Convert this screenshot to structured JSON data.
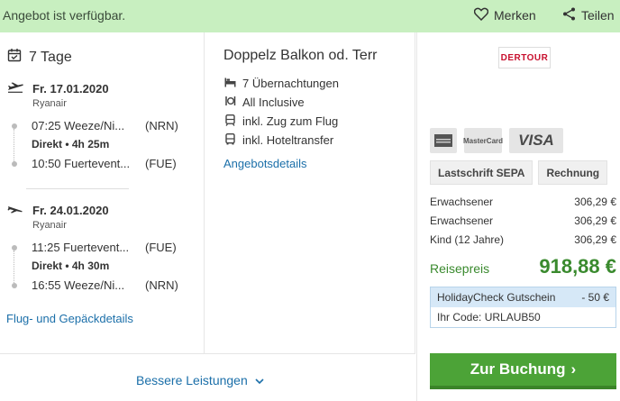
{
  "banner": {
    "availability": "Angebot ist verfügbar.",
    "save_label": "Merken",
    "share_label": "Teilen",
    "save_icon": "heart-icon",
    "share_icon": "share-icon"
  },
  "trip": {
    "duration": "7 Tage"
  },
  "outbound": {
    "date": "Fr. 17.01.2020",
    "airline": "Ryanair",
    "dep": {
      "time_place": "07:25 Weeze/Ni...",
      "code": "(NRN)"
    },
    "direct": "Direkt • 4h 25m",
    "arr": {
      "time_place": "10:50 Fuertevent...",
      "code": "(FUE)"
    }
  },
  "inbound": {
    "date": "Fr. 24.01.2020",
    "airline": "Ryanair",
    "dep": {
      "time_place": "11:25 Fuertevent...",
      "code": "(FUE)"
    },
    "direct": "Direkt • 4h 30m",
    "arr": {
      "time_place": "16:55 Weeze/Ni...",
      "code": "(NRN)"
    }
  },
  "flight_details_link": "Flug- und Gepäckdetails",
  "hotel": {
    "room": "Doppelz Balkon od. Terr",
    "features": [
      {
        "icon": "bed-icon",
        "label": "7 Übernachtungen"
      },
      {
        "icon": "cutlery-icon",
        "label": "All Inclusive"
      },
      {
        "icon": "train-icon",
        "label": "inkl. Zug zum Flug"
      },
      {
        "icon": "bus-icon",
        "label": "inkl. Hoteltransfer"
      }
    ],
    "details_link": "Angebotsdetails"
  },
  "operator": {
    "logo_text": "DERTOUR"
  },
  "payment": {
    "cards": [
      "AMEX",
      "MasterCard",
      "VISA"
    ],
    "methods": [
      "Lastschrift SEPA",
      "Rechnung"
    ]
  },
  "prices": {
    "rows": [
      {
        "label": "Erwachsener",
        "amount": "306,29 €"
      },
      {
        "label": "Erwachsener",
        "amount": "306,29 €"
      },
      {
        "label": "Kind (12 Jahre)",
        "amount": "306,29 €"
      }
    ],
    "total_label": "Reisepreis",
    "total_amount": "918,88 €"
  },
  "voucher": {
    "name": "HolidayCheck Gutschein",
    "discount": "- 50 €",
    "code_line": "Ihr Code: URLAUB50"
  },
  "cta": {
    "label": "Zur Buchung",
    "arrow": "›"
  },
  "more": {
    "label": "Bessere Leistungen",
    "chevron": "⌄"
  },
  "colors": {
    "banner": "#c8efc0",
    "link": "#1b6fa9",
    "price": "#3a8a2e",
    "cta": "#4ca337"
  }
}
